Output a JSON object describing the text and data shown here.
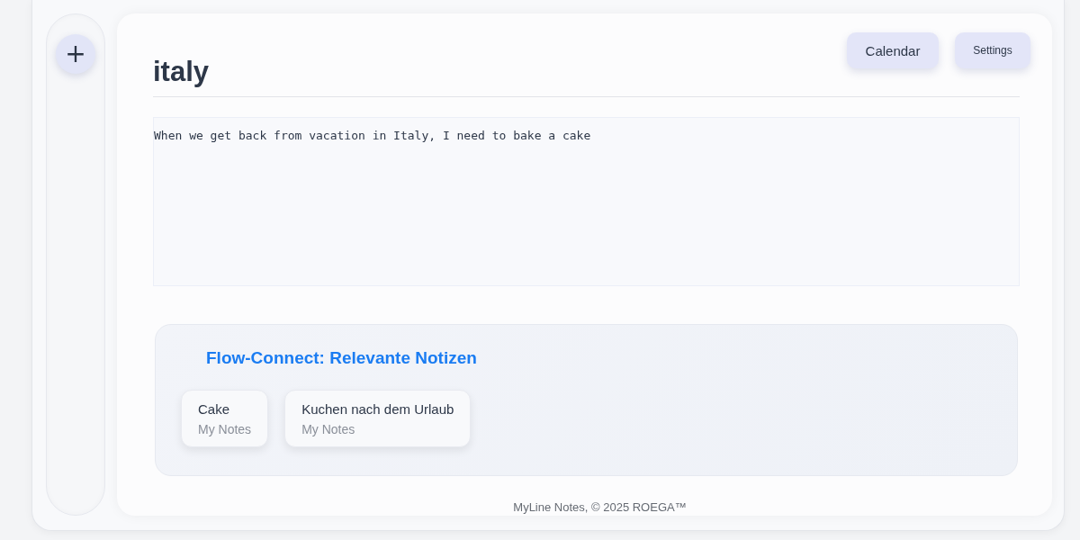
{
  "sidebar": {
    "add_button": "+"
  },
  "note": {
    "title": "italy",
    "text": "When we get back from vacation in Italy, I need to bake a cake"
  },
  "header_buttons": [
    "Calendar",
    "Settings"
  ],
  "flow_connect": {
    "heading": "Flow-Connect: Relevante Notizen",
    "cards": [
      {
        "title": "Cake",
        "source": "My Notes"
      },
      {
        "title": "Kuchen nach dem Urlaub",
        "source": "My Notes"
      }
    ]
  },
  "footer": "MyLine Notes, © 2025 ROEGA™"
}
